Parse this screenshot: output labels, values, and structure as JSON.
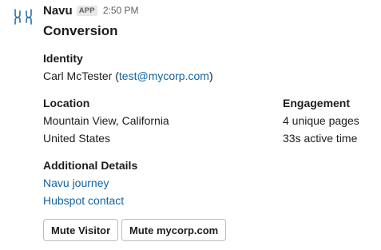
{
  "message": {
    "sender": "Navu",
    "badge": "APP",
    "time": "2:50 PM",
    "title": "Conversion",
    "avatar_icon": "navu-logo-icon"
  },
  "identity": {
    "label": "Identity",
    "name": "Carl McTester",
    "open_paren": " (",
    "email": "test@mycorp.com",
    "close_paren": ")"
  },
  "location": {
    "label": "Location",
    "line1": "Mountain View, California",
    "line2": "United States"
  },
  "engagement": {
    "label": "Engagement",
    "pages": "4 unique pages",
    "active_time": "33s active time"
  },
  "additional": {
    "label": "Additional Details",
    "link1": "Navu journey",
    "link2": "Hubspot contact"
  },
  "actions": {
    "mute_visitor": "Mute Visitor",
    "mute_domain": "Mute mycorp.com"
  },
  "colors": {
    "link": "#1264a3",
    "text": "#1d1c1d",
    "muted": "#616061",
    "logo": "#2a6fa3"
  }
}
